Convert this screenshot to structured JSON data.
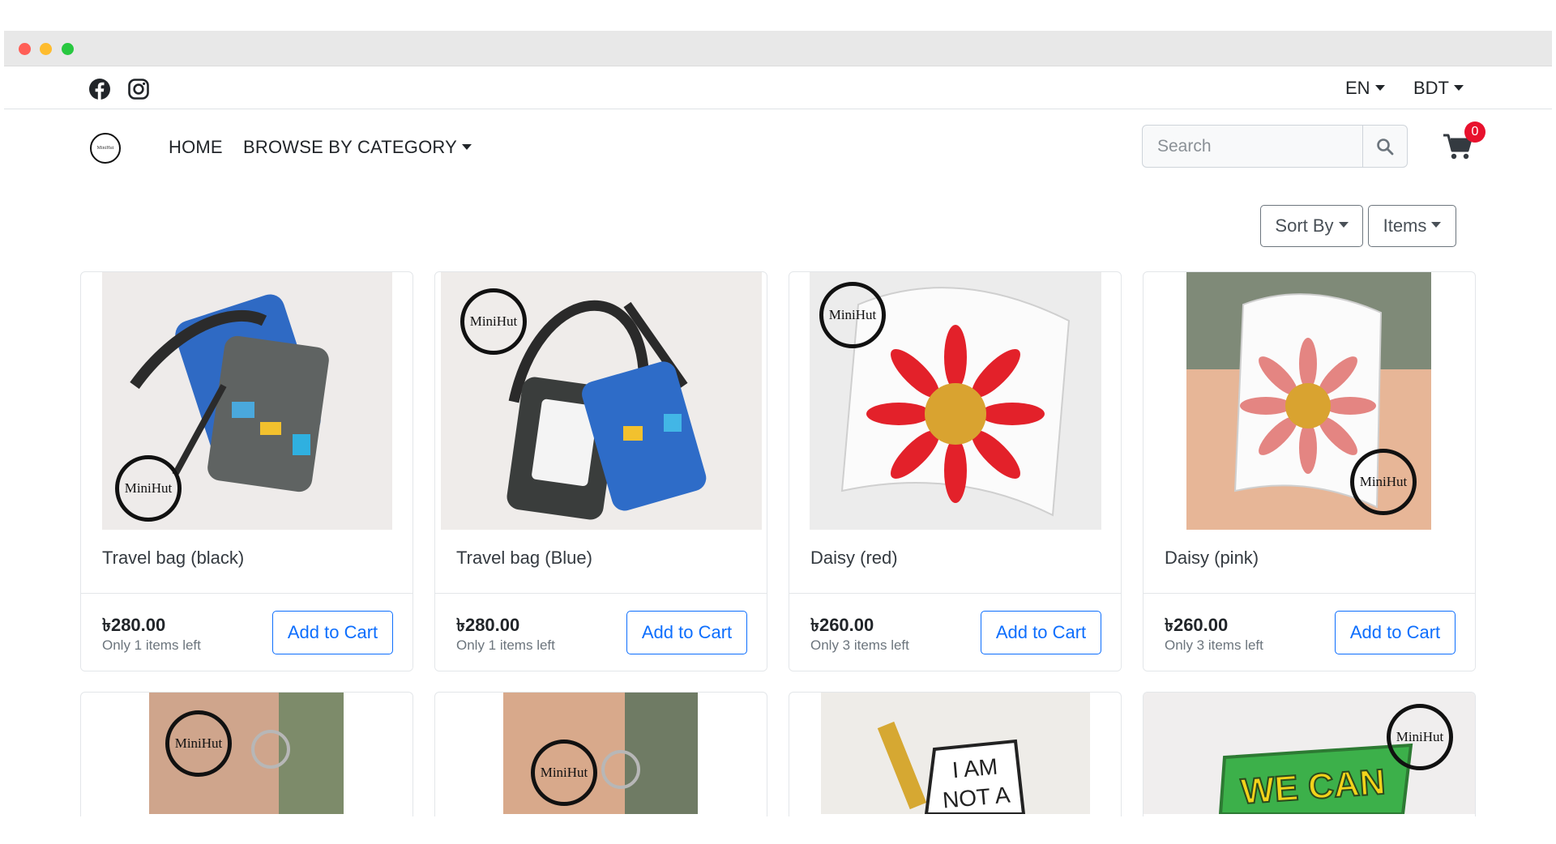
{
  "topbar": {
    "language": "EN",
    "currency": "BDT",
    "social_icons": [
      "facebook-icon",
      "instagram-icon"
    ]
  },
  "navbar": {
    "logo_text": "MiniHut",
    "links": [
      "HOME",
      "BROWSE BY CATEGORY"
    ],
    "search_placeholder": "Search",
    "cart_count": "0"
  },
  "toolbar": {
    "sort_label": "Sort By",
    "items_label": "Items"
  },
  "products": [
    {
      "title": "Travel bag (black)",
      "price": "৳280.00",
      "stock": "Only 1 items left",
      "button": "Add to Cart",
      "stamp": "MiniHut"
    },
    {
      "title": "Travel bag (Blue)",
      "price": "৳280.00",
      "stock": "Only 1 items left",
      "button": "Add to Cart",
      "stamp": "MiniHut"
    },
    {
      "title": "Daisy (red)",
      "price": "৳260.00",
      "stock": "Only 3 items left",
      "button": "Add to Cart",
      "stamp": "MiniHut"
    },
    {
      "title": "Daisy (pink)",
      "price": "৳260.00",
      "stock": "Only 3 items left",
      "button": "Add to Cart",
      "stamp": "MiniHut"
    }
  ],
  "second_row": [
    {
      "stamp": "MiniHut"
    },
    {
      "stamp": "MiniHut"
    },
    {
      "pin_text_1": "I AM",
      "pin_text_2": "NOT A"
    },
    {
      "stamp": "MiniHut",
      "pin_text": "WE CAN"
    }
  ],
  "colors": {
    "accent": "#0d6efd",
    "badge": "#e8112d"
  }
}
